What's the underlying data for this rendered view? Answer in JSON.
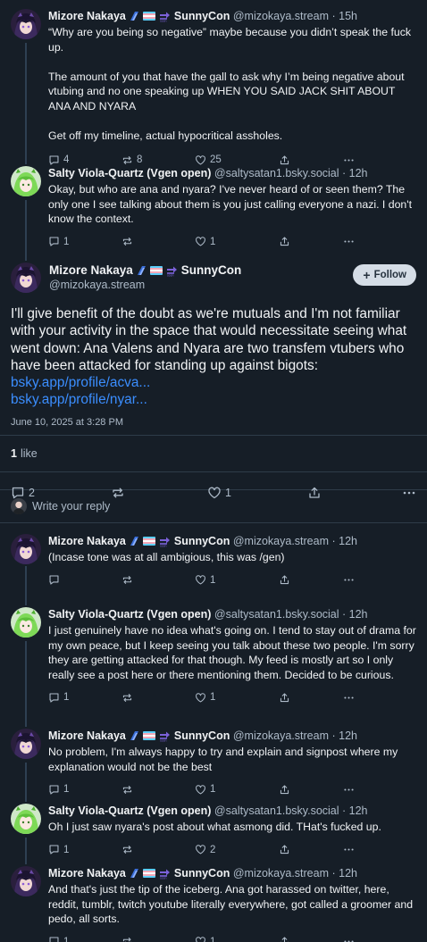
{
  "colors": {
    "background": "#161e27",
    "link": "#3b8eff",
    "muted": "#aebbc9"
  },
  "thread": [
    {
      "name": "Mizore Nakaya",
      "badges": [
        "wing-icon",
        "trans-flag-icon",
        "soon-arrow-icon"
      ],
      "suffix": "SunnyCon",
      "handle": "@mizokaya.stream",
      "time": "· 15h",
      "text": "“Why are you being so negative” maybe because you didn’t speak the fuck up.\n\nThe amount of you that have the gall to ask why I’m being negative about vtubing and no one speaking up WHEN YOU SAID JACK SHIT ABOUT ANA AND NYARA\n\nGet off my timeline, actual hypocritical assholes.",
      "replies": "4",
      "reposts": "8",
      "likes": "25"
    },
    {
      "name": "Salty Viola-Quartz (Vgen open)",
      "handle": "@saltysatan1.bsky.social",
      "time": "· 12h",
      "text": "Okay, but who are ana and nyara? I've never heard of or seen them? The only one I see talking about them is you just calling everyone a nazi. I don't know the context.",
      "replies": "1",
      "reposts": "",
      "likes": "1"
    }
  ],
  "focus": {
    "name": "Mizore Nakaya",
    "suffix": "SunnyCon",
    "handle": "@mizokaya.stream",
    "follow_label": "Follow",
    "text": "I'll give benefit of the doubt as we're mutuals and I'm not familiar with your activity in the space that would necessitate seeing what went down: Ana Valens and Nyara are two transfem vtubers who have been attacked for standing up against bigots:",
    "link1": "bsky.app/profile/acva...",
    "link2": "bsky.app/profile/nyar...",
    "timestamp": "June 10, 2025 at 3:28 PM",
    "likes_count": "1",
    "likes_label": "like",
    "replies": "2",
    "reposts": "",
    "likes": "1"
  },
  "write_reply": "Write your reply",
  "replies": [
    {
      "name": "Mizore Nakaya",
      "badges": true,
      "suffix": "SunnyCon",
      "handle": "@mizokaya.stream",
      "time": "· 12h",
      "text": "(Incase tone was at all ambigious, this was /gen)",
      "replies": "",
      "reposts": "",
      "likes": "1"
    },
    {
      "name": "Salty Viola-Quartz (Vgen open)",
      "badges": false,
      "suffix": "",
      "handle": "@saltysatan1.bsky.social",
      "time": "· 12h",
      "text": "I just genuinely have no idea what's going on. I tend to stay out of drama for my own peace, but I keep seeing you talk about these two people. I'm sorry they are getting attacked for that though. My feed is mostly art so I only really see a post here or there mentioning them. Decided to be curious.",
      "replies": "1",
      "reposts": "",
      "likes": "1"
    },
    {
      "name": "Mizore Nakaya",
      "badges": true,
      "suffix": "SunnyCon",
      "handle": "@mizokaya.stream",
      "time": "· 12h",
      "text": "No problem, I'm always happy to try and explain and signpost where my explanation would not be the best",
      "replies": "1",
      "reposts": "",
      "likes": "1"
    },
    {
      "name": "Salty Viola-Quartz (Vgen open)",
      "badges": false,
      "suffix": "",
      "handle": "@saltysatan1.bsky.social",
      "time": "· 12h",
      "text": "Oh I just saw nyara's post about what asmong did. THat's fucked up.",
      "replies": "1",
      "reposts": "",
      "likes": "2"
    },
    {
      "name": "Mizore Nakaya",
      "badges": true,
      "suffix": "SunnyCon",
      "handle": "@mizokaya.stream",
      "time": "· 12h",
      "text": "And that's just the tip of the iceberg. Ana got harassed on twitter, here, reddit, tumblr, twitch youtube literally everywhere, got called a groomer and pedo, all sorts.",
      "replies": "1",
      "reposts": "",
      "likes": "1"
    }
  ]
}
